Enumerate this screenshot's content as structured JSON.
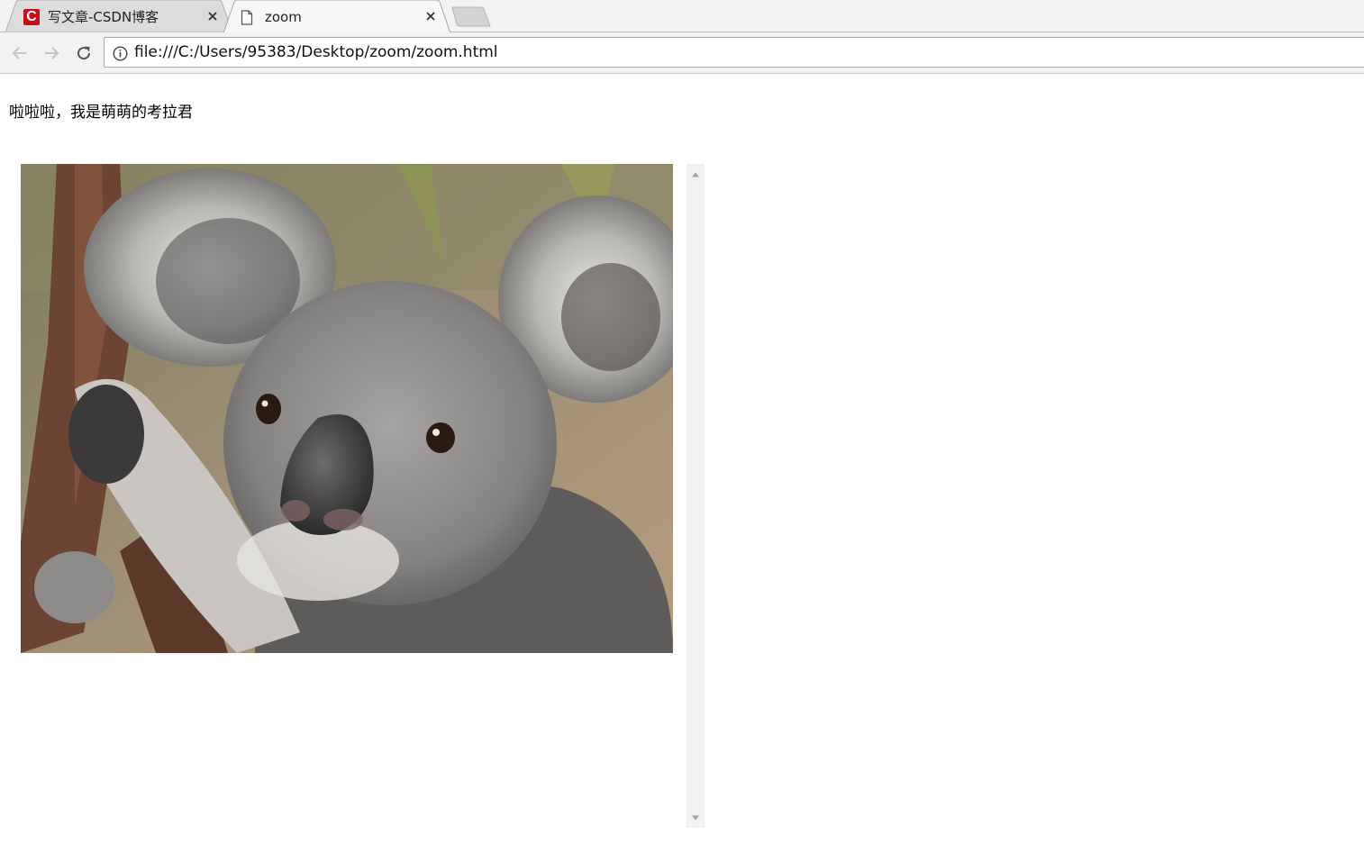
{
  "browser": {
    "tabs": [
      {
        "title": "写文章-CSDN博客",
        "icon": "csdn-logo-icon",
        "active": false
      },
      {
        "title": "zoom",
        "icon": "page-document-icon",
        "active": true
      }
    ],
    "address_bar": {
      "url": "file:///C:/Users/95383/Desktop/zoom/zoom.html",
      "security_icon": "info-icon"
    },
    "nav": {
      "back_icon": "back-arrow-icon",
      "forward_icon": "forward-arrow-icon",
      "reload_icon": "reload-icon"
    }
  },
  "page": {
    "paragraph": "啦啦啦，我是萌萌的考拉君",
    "image": {
      "subject": "koala photo"
    },
    "scrollbar": {
      "up_icon": "scroll-up-arrow-icon",
      "down_icon": "scroll-down-arrow-icon"
    }
  },
  "colors": {
    "chrome_bg": "#f2f2f2",
    "csdn_red": "#ca0c16",
    "scrollbar_track": "#f1f1f1"
  }
}
